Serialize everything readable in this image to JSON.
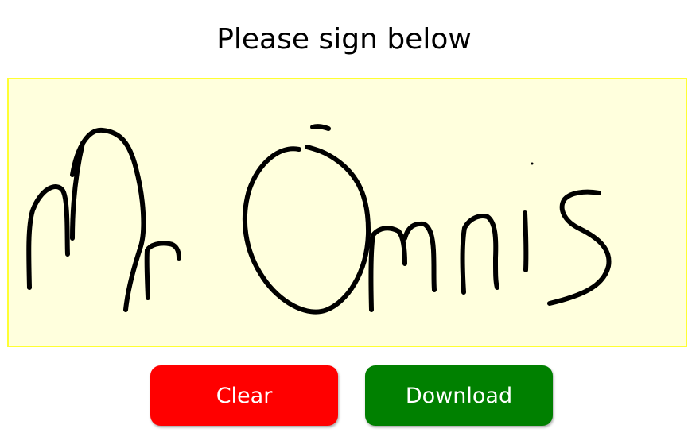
{
  "title": "Please sign below",
  "signature_pad": {
    "background": "#ffffdd",
    "border": "#ffff33",
    "ink": "#000000",
    "content": "Mr Omnis"
  },
  "buttons": {
    "clear": {
      "label": "Clear",
      "color": "#ff0000"
    },
    "download": {
      "label": "Download",
      "color": "#008000"
    }
  }
}
